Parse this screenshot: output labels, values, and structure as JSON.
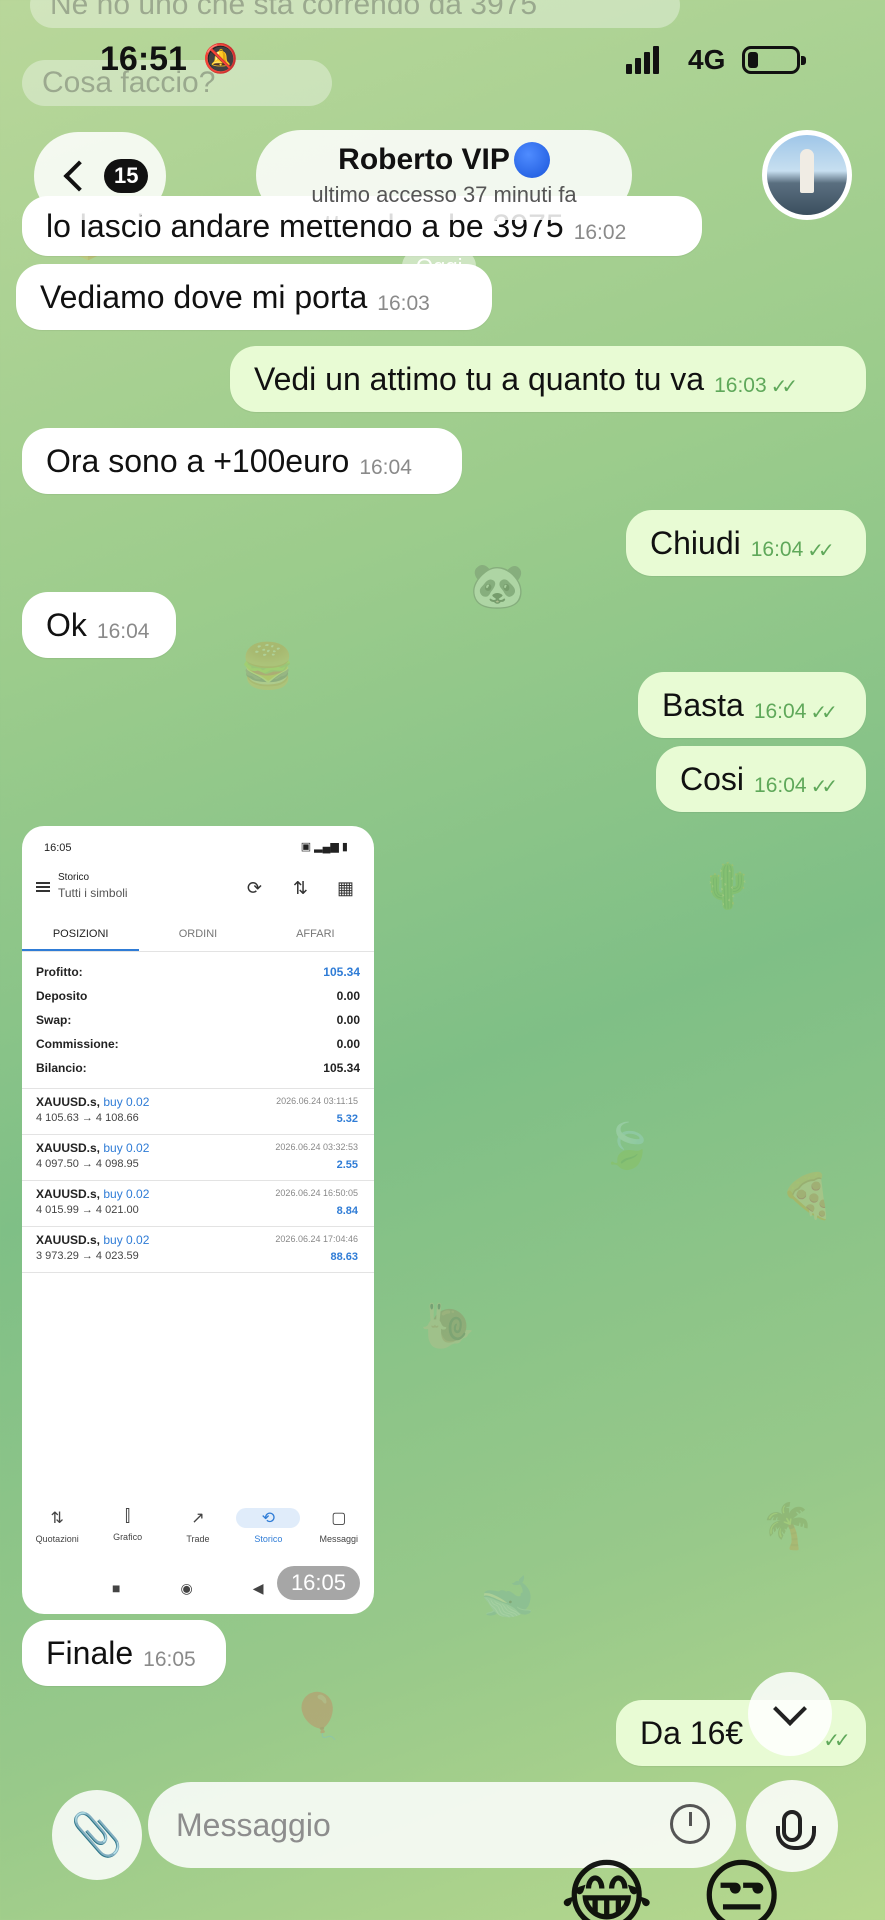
{
  "status_bar": {
    "time": "16:51",
    "network": "4G"
  },
  "faded_messages": [
    "Ne ho uno che sta correndo da 3975",
    "Cosa faccio?"
  ],
  "header": {
    "back_count": "15",
    "contact_name": "Roberto VIP",
    "last_seen": "ultimo accesso 37 minuti fa"
  },
  "date_chip": "Oggi",
  "messages": [
    {
      "dir": "in",
      "text": "lo lascio andare mettendo a be 3975",
      "time": "16:02"
    },
    {
      "dir": "in",
      "text": "Vediamo dove mi porta",
      "time": "16:03"
    },
    {
      "dir": "out",
      "text": "Vedi un attimo tu a quanto tu va",
      "time": "16:03"
    },
    {
      "dir": "in",
      "text": "Ora sono a +100euro",
      "time": "16:04"
    },
    {
      "dir": "out",
      "text": "Chiudi",
      "time": "16:04"
    },
    {
      "dir": "in",
      "text": "Ok",
      "time": "16:04"
    },
    {
      "dir": "out",
      "text": "Basta",
      "time": "16:04"
    },
    {
      "dir": "out",
      "text": "Cosi",
      "time": "16:04"
    },
    {
      "dir": "in",
      "text": "Finale",
      "time": "16:05"
    },
    {
      "dir": "out",
      "text": "Da 16€",
      "time": ""
    }
  ],
  "screenshot": {
    "status_time": "16:05",
    "header_small": "Storico",
    "header_sub": "Tutti i simboli",
    "tabs": [
      "POSIZIONI",
      "ORDINI",
      "AFFARI"
    ],
    "summary": [
      {
        "label": "Profitto:",
        "value": "105.34"
      },
      {
        "label": "Deposito",
        "value": "0.00"
      },
      {
        "label": "Swap:",
        "value": "0.00"
      },
      {
        "label": "Commissione:",
        "value": "0.00"
      },
      {
        "label": "Bilancio:",
        "value": "105.34"
      }
    ],
    "trades": [
      {
        "symbol": "XAUUSD.s,",
        "side": "buy 0.02",
        "prices": "4 105.63 → 4 108.66",
        "date": "2026.06.24 03:11:15",
        "profit": "5.32"
      },
      {
        "symbol": "XAUUSD.s,",
        "side": "buy 0.02",
        "prices": "4 097.50 → 4 098.95",
        "date": "2026.06.24 03:32:53",
        "profit": "2.55"
      },
      {
        "symbol": "XAUUSD.s,",
        "side": "buy 0.02",
        "prices": "4 015.99 → 4 021.00",
        "date": "2026.06.24 16:50:05",
        "profit": "8.84"
      },
      {
        "symbol": "XAUUSD.s,",
        "side": "buy 0.02",
        "prices": "3 973.29 → 4 023.59",
        "date": "2026.06.24 17:04:46",
        "profit": "88.63"
      }
    ],
    "nav": [
      "Quotazioni",
      "Grafico",
      "Trade",
      "Storico",
      "Messaggi"
    ],
    "time_chip": "16:05"
  },
  "composer": {
    "placeholder": "Messaggio"
  },
  "colors": {
    "incoming": "#ffffff",
    "outgoing": "#e8fbd4",
    "accent": "#2f7cd6",
    "ticks": "#5fa85a"
  }
}
